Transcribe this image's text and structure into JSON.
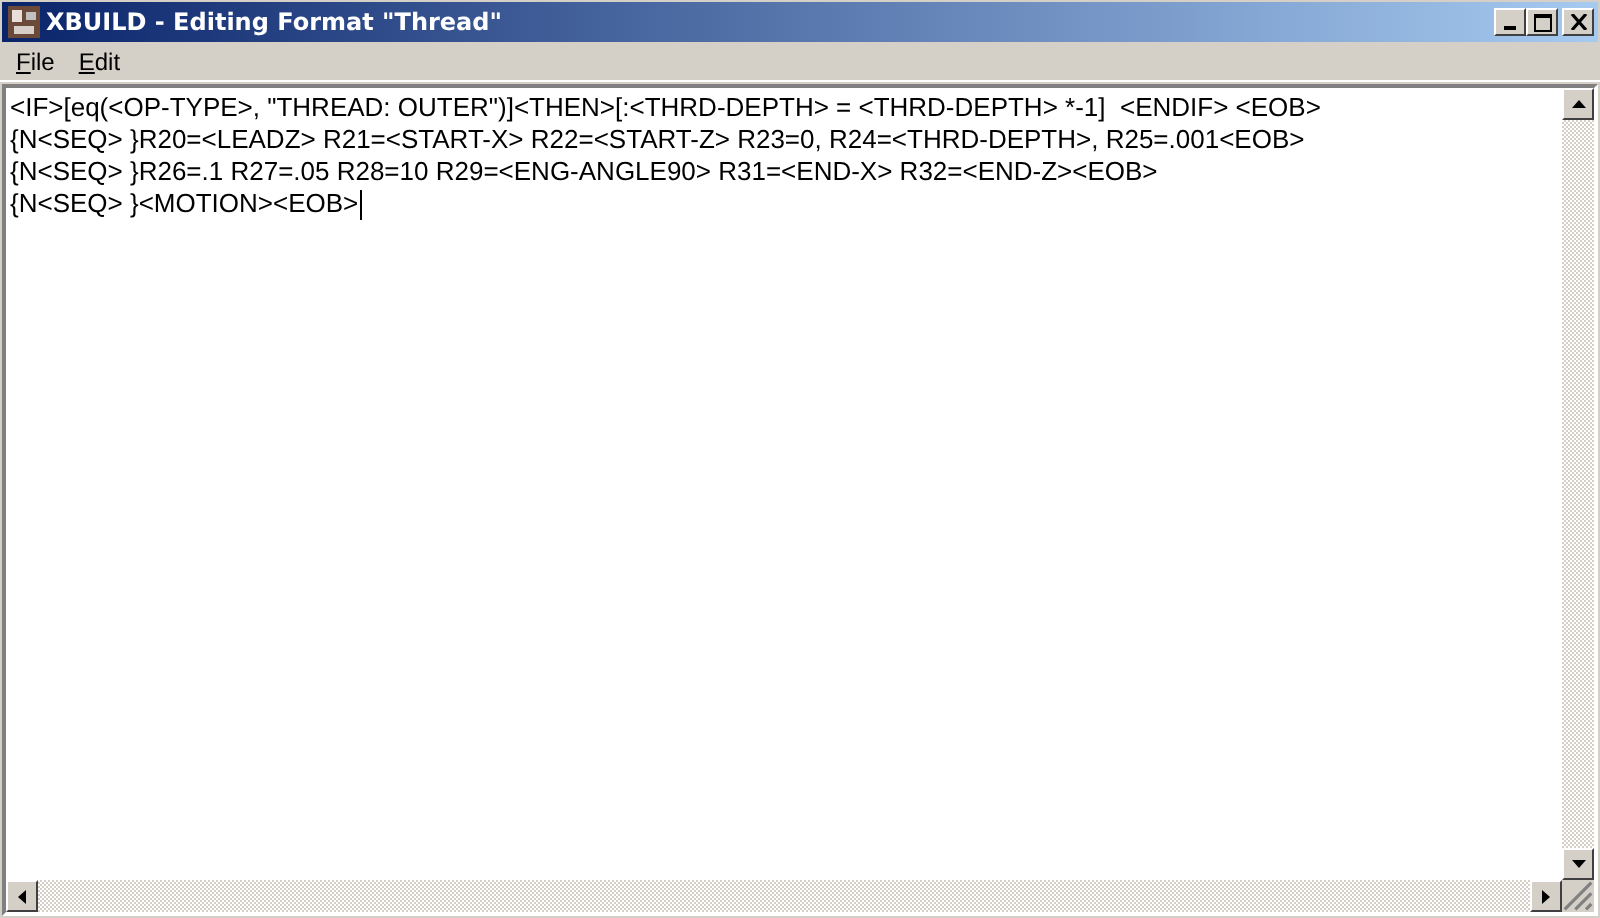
{
  "window": {
    "title": "XBUILD - Editing Format \"Thread\""
  },
  "menu": [
    {
      "accel": "F",
      "rest": "ile"
    },
    {
      "accel": "E",
      "rest": "dit"
    }
  ],
  "editor": {
    "lines": [
      {
        "text": "<IF>[eq(<OP-TYPE>, \"THREAD: OUTER\")]<THEN>[:<THRD-DEPTH> = <THRD-DEPTH> *-1]  <ENDIF> <EOB>",
        "caret": false
      },
      {
        "text": "{N<SEQ> }R20=<LEADZ> R21=<START-X> R22=<START-Z> R23=0, R24=<THRD-DEPTH>, R25=.001<EOB>",
        "caret": false
      },
      {
        "text": "{N<SEQ> }R26=.1 R27=.05 R28=10 R29=<ENG-ANGLE90> R31=<END-X> R32=<END-Z><EOB>",
        "caret": false
      },
      {
        "text": "{N<SEQ> }<MOTION><EOB>",
        "caret": true
      }
    ]
  }
}
